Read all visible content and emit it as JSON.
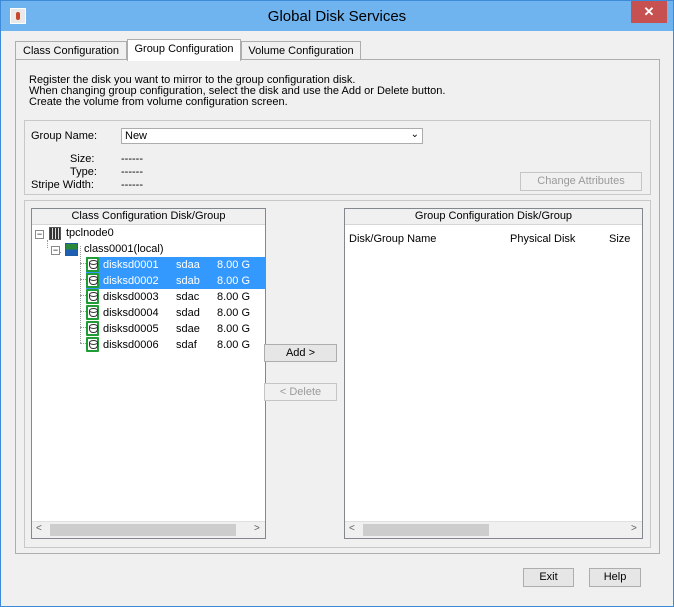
{
  "window": {
    "title": "Global Disk Services",
    "close_glyph": "✕",
    "icon": "java-app-icon"
  },
  "tabs": [
    {
      "label": "Class Configuration",
      "active": false
    },
    {
      "label": "Group Configuration",
      "active": true
    },
    {
      "label": "Volume Configuration",
      "active": false
    }
  ],
  "description": [
    "Register the disk you want to mirror to the group configuration disk.",
    "When changing group configuration, select the disk and use the Add or Delete button.",
    "Create the volume from volume configuration screen."
  ],
  "group": {
    "name_label": "Group Name:",
    "name_value": "New",
    "size_label": "Size:",
    "size_value": "------",
    "type_label": "Type:",
    "type_value": "------",
    "stripe_label": "Stripe Width:",
    "stripe_value": "------",
    "change_attributes": "Change Attributes"
  },
  "class_tree": {
    "header": "Class Configuration Disk/Group",
    "node": "tpclnode0",
    "class": "class0001(local)",
    "disks": [
      {
        "name": "disksd0001",
        "device": "sdaa",
        "size": "8.00 G",
        "selected": true
      },
      {
        "name": "disksd0002",
        "device": "sdab",
        "size": "8.00 G",
        "selected": true
      },
      {
        "name": "disksd0003",
        "device": "sdac",
        "size": "8.00 G",
        "selected": false
      },
      {
        "name": "disksd0004",
        "device": "sdad",
        "size": "8.00 G",
        "selected": false
      },
      {
        "name": "disksd0005",
        "device": "sdae",
        "size": "8.00 G",
        "selected": false
      },
      {
        "name": "disksd0006",
        "device": "sdaf",
        "size": "8.00 G",
        "selected": false
      }
    ]
  },
  "group_list": {
    "header": "Group Configuration Disk/Group",
    "columns": [
      "Disk/Group Name",
      "Physical Disk",
      "Size"
    ]
  },
  "buttons": {
    "add": "Add >",
    "delete": "< Delete",
    "exit": "Exit",
    "help": "Help"
  },
  "scroll": {
    "left_arrow": "<",
    "right_arrow": ">"
  }
}
